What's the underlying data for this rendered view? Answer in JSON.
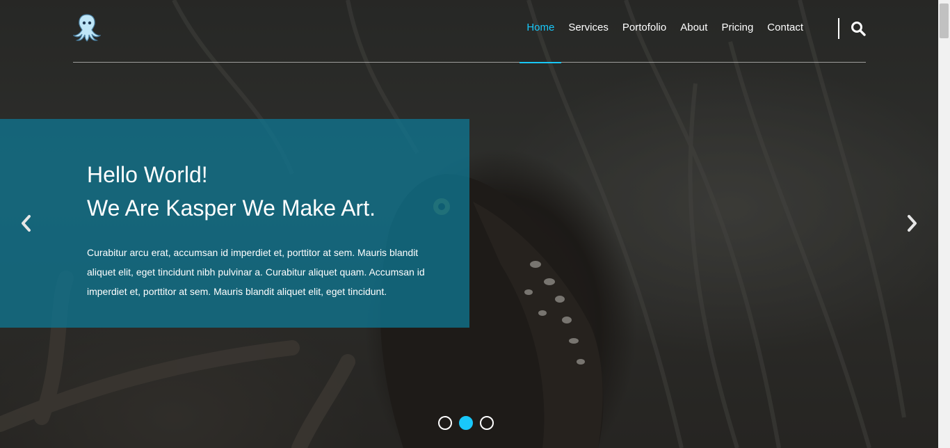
{
  "brand": {
    "logo_icon": "octopus-icon",
    "accent_color": "#19c8fa"
  },
  "nav": {
    "items": [
      {
        "label": "Home",
        "active": true
      },
      {
        "label": "Services",
        "active": false
      },
      {
        "label": "Portofolio",
        "active": false
      },
      {
        "label": "About",
        "active": false
      },
      {
        "label": "Pricing",
        "active": false
      },
      {
        "label": "Contact",
        "active": false
      }
    ],
    "search_icon": "search-icon"
  },
  "hero": {
    "headline_line1": "Hello World!",
    "headline_line2": "We Are Kasper We Make Art.",
    "description": "Curabitur arcu erat, accumsan id imperdiet et, porttitor at sem. Mauris blandit aliquet elit, eget tincidunt nibh pulvinar a. Curabitur aliquet quam. Accumsan id imperdiet et, porttitor at sem. Mauris blandit aliquet elit, eget tincidunt.",
    "box_color": "#0f748f"
  },
  "slider": {
    "prev_icon": "chevron-left-icon",
    "next_icon": "chevron-right-icon",
    "slide_count": 3,
    "active_index": 2
  }
}
